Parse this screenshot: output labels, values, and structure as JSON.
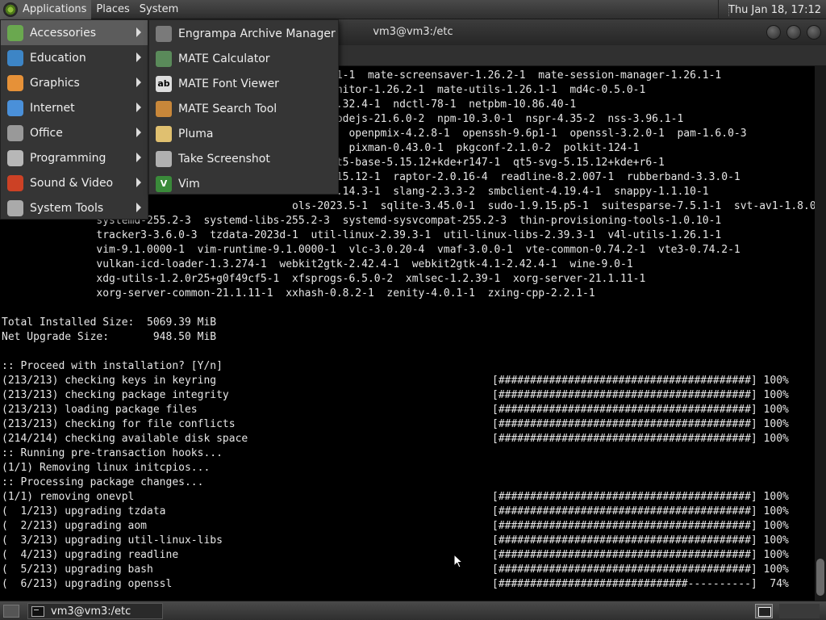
{
  "top_panel": {
    "menus": [
      "Applications",
      "Places",
      "System"
    ],
    "clock": "Thu Jan 18, 17:12"
  },
  "window": {
    "title": "vm3@vm3:/etc"
  },
  "apps_menu": {
    "categories": [
      {
        "label": "Accessories",
        "icon": "accessories-icon",
        "color": "#6aa84f"
      },
      {
        "label": "Education",
        "icon": "education-icon",
        "color": "#3d85c6"
      },
      {
        "label": "Graphics",
        "icon": "graphics-icon",
        "color": "#e69138"
      },
      {
        "label": "Internet",
        "icon": "internet-icon",
        "color": "#4a90d9"
      },
      {
        "label": "Office",
        "icon": "office-icon",
        "color": "#999999"
      },
      {
        "label": "Programming",
        "icon": "programming-icon",
        "color": "#b7b7b7"
      },
      {
        "label": "Sound & Video",
        "icon": "sound-video-icon",
        "color": "#cc4125"
      },
      {
        "label": "System Tools",
        "icon": "system-tools-icon",
        "color": "#aaaaaa"
      }
    ],
    "accessories": [
      {
        "label": "Engrampa Archive Manager",
        "icon": "archive-manager-icon"
      },
      {
        "label": "MATE Calculator",
        "icon": "calculator-icon"
      },
      {
        "label": "MATE Font Viewer",
        "icon": "font-viewer-icon"
      },
      {
        "label": "MATE Search Tool",
        "icon": "search-tool-icon"
      },
      {
        "label": "Pluma",
        "icon": "text-editor-icon"
      },
      {
        "label": "Take Screenshot",
        "icon": "screenshot-icon"
      },
      {
        "label": "Vim",
        "icon": "vim-icon"
      }
    ]
  },
  "terminal": {
    "lines": [
      {
        "text": "                                              r-1.26.1-1  mate-screensaver-1.26.2-1  mate-session-manager-1.26.1-1"
      },
      {
        "text": "                                             ystem-monitor-1.26.2-1  mate-utils-1.26.1-1  md4c-0.5.0-1"
      },
      {
        "text": "                                              pg123-1.32.4-1  ndctl-78-1  netpbm-10.86.40-1"
      },
      {
        "text": "                                              00-3  nodejs-21.6.0-2  npm-10.3.0-1  nspr-4.35-2  nss-3.96.1-1"
      },
      {
        "text": "                                              4.1.6-2  openpmix-4.2.8-1  openssh-9.6p1-1  openssl-3.2.0-1  pam-1.6.0-3"
      },
      {
        "text": "                                              .38.1-1  pixman-0.43.0-1  pkgconf-2.1.0-2  polkit-124-1"
      },
      {
        "text": "                                              .0-1  qt5-base-5.15.12+kde+r147-1  qt5-svg-5.15.12+kde+r6-1"
      },
      {
        "text": "                                              tras-5.15.12-1  raptor-2.0.16-4  readline-8.2.007-1  rubberband-3.3.0-1"
      },
      {
        "text": "                                              hadow-4.14.3-1  slang-2.3.3-2  smbclient-4.19.4-1  snappy-1.1.10-1"
      },
      {
        "text": "                                              ols-2023.5-1  sqlite-3.45.0-1  sudo-1.9.15.p5-1  suitesparse-7.5.1-1  svt-av1-1.8.0-1"
      },
      {
        "text": "               systemd-255.2-3  systemd-libs-255.2-3  systemd-sysvcompat-255.2-3  thin-provisioning-tools-1.0.10-1"
      },
      {
        "text": "               tracker3-3.6.0-3  tzdata-2023d-1  util-linux-2.39.3-1  util-linux-libs-2.39.3-1  v4l-utils-1.26.1-1"
      },
      {
        "text": "               vim-9.1.0000-1  vim-runtime-9.1.0000-1  vlc-3.0.20-4  vmaf-3.0.0-1  vte-common-0.74.2-1  vte3-0.74.2-1"
      },
      {
        "text": "               vulkan-icd-loader-1.3.274-1  webkit2gtk-2.42.4-1  webkit2gtk-4.1-2.42.4-1  wine-9.0-1"
      },
      {
        "text": "               xdg-utils-1.2.0r25+g0f49cf5-1  xfsprogs-6.5.0-2  xmlsec-1.2.39-1  xorg-server-21.1.11-1"
      },
      {
        "text": "               xorg-server-common-21.1.11-1  xxhash-0.8.2-1  zenity-4.0.1-1  zxing-cpp-2.2.1-1"
      },
      {
        "text": ""
      },
      {
        "text": "Total Installed Size:  5069.39 MiB"
      },
      {
        "text": "Net Upgrade Size:       948.50 MiB"
      },
      {
        "text": ""
      },
      {
        "text": ":: Proceed with installation? [Y/n]"
      },
      {
        "text": "(213/213) checking keys in keyring",
        "progress": "[########################################] 100%"
      },
      {
        "text": "(213/213) checking package integrity",
        "progress": "[########################################] 100%"
      },
      {
        "text": "(213/213) loading package files",
        "progress": "[########################################] 100%"
      },
      {
        "text": "(213/213) checking for file conflicts",
        "progress": "[########################################] 100%"
      },
      {
        "text": "(214/214) checking available disk space",
        "progress": "[########################################] 100%"
      },
      {
        "text": ":: Running pre-transaction hooks..."
      },
      {
        "text": "(1/1) Removing linux initcpios..."
      },
      {
        "text": ":: Processing package changes..."
      },
      {
        "text": "(1/1) removing onevpl",
        "progress": "[########################################] 100%"
      },
      {
        "text": "(  1/213) upgrading tzdata",
        "progress": "[########################################] 100%"
      },
      {
        "text": "(  2/213) upgrading aom",
        "progress": "[########################################] 100%"
      },
      {
        "text": "(  3/213) upgrading util-linux-libs",
        "progress": "[########################################] 100%"
      },
      {
        "text": "(  4/213) upgrading readline",
        "progress": "[########################################] 100%"
      },
      {
        "text": "(  5/213) upgrading bash",
        "progress": "[########################################] 100%"
      },
      {
        "text": "(  6/213) upgrading openssl",
        "progress": "[##############################----------]  74%"
      }
    ]
  },
  "bottom_panel": {
    "task_label": "vm3@vm3:/etc"
  }
}
